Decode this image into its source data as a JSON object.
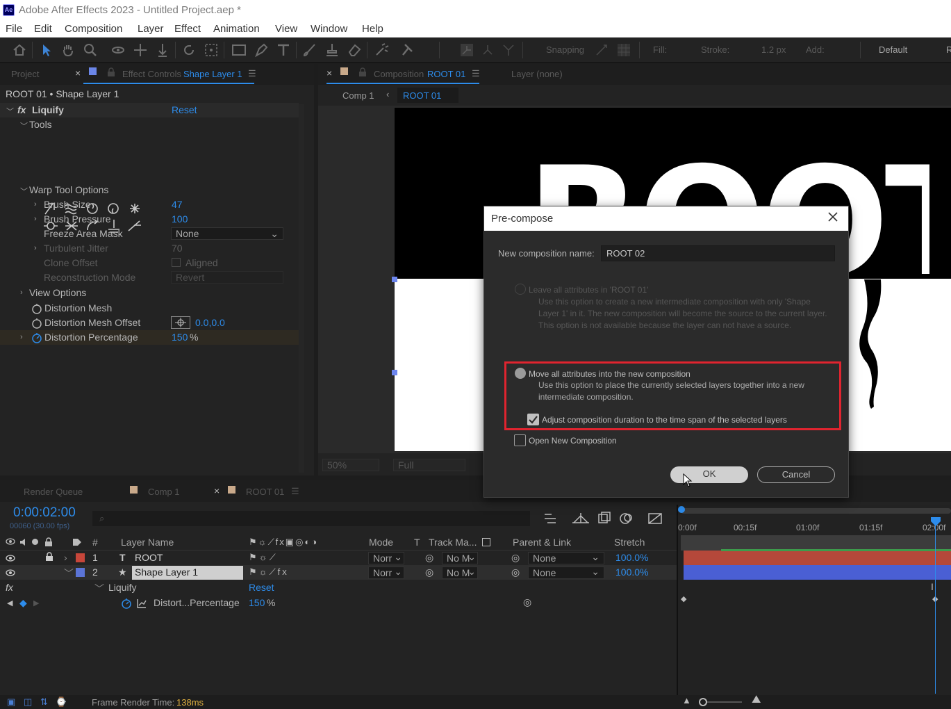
{
  "app": {
    "title": "Adobe After Effects 2023 - Untitled Project.aep *",
    "logo": "Ae"
  },
  "menu": [
    "File",
    "Edit",
    "Composition",
    "Layer",
    "Effect",
    "Animation",
    "View",
    "Window",
    "Help"
  ],
  "toolbar": {
    "snapping_label": "Snapping",
    "fill_label": "Fill:",
    "stroke_label": "Stroke:",
    "stroke_width": "1.2 px",
    "add_label": "Add:",
    "workspace": "Default",
    "workspace_cut": "R"
  },
  "left_panel": {
    "tab_project": "Project",
    "tab_effect_prefix": "Effect Controls",
    "tab_effect_layer": "Shape Layer 1",
    "breadcrumb": "ROOT 01 • Shape Layer 1",
    "effect_name": "Liquify",
    "reset": "Reset",
    "tools_label": "Tools",
    "warp_label": "Warp Tool Options",
    "brush_size_label": "Brush Size",
    "brush_size_value": "47",
    "brush_pressure_label": "Brush Pressure",
    "brush_pressure_value": "100",
    "freeze_label": "Freeze Area Mask",
    "freeze_value": "None",
    "turbulent_label": "Turbulent Jitter",
    "turbulent_value": "70",
    "clone_label": "Clone Offset",
    "clone_value": "Aligned",
    "recon_label": "Reconstruction Mode",
    "recon_value": "Revert",
    "view_options_label": "View Options",
    "mesh_label": "Distortion Mesh",
    "mesh_offset_label": "Distortion Mesh Offset",
    "mesh_offset_value": "0.0,0.0",
    "percentage_label": "Distortion Percentage",
    "percentage_value": "150",
    "percentage_unit": "%"
  },
  "comp_panel": {
    "tab_prefix": "Composition",
    "tab_name": "ROOT 01",
    "layer_tab": "Layer (none)",
    "crumb_comp1": "Comp 1",
    "crumb_root": "ROOT 01",
    "canvas_text": "ROOT",
    "zoom": "50%",
    "resolution": "Full"
  },
  "dialog": {
    "title": "Pre-compose",
    "name_label": "New composition name:",
    "name_value": "ROOT 02",
    "option1_label": "Leave all attributes in 'ROOT 01'",
    "option1_desc": "Use this option to create a new intermediate composition with only 'Shape Layer 1' in it. The new composition will become the source to the current layer. This option is not available because the layer can not have a source.",
    "option2_label": "Move all attributes into the new composition",
    "option2_desc": "Use this option to place the currently selected layers together into a new intermediate composition.",
    "adjust_label": "Adjust composition duration to the time span of the selected layers",
    "open_label": "Open New Composition",
    "ok": "OK",
    "cancel": "Cancel"
  },
  "timeline": {
    "tab_render": "Render Queue",
    "tab_comp1": "Comp 1",
    "tab_root": "ROOT 01",
    "timecode": "0:00:02:00",
    "fps": "00060 (30.00 fps)",
    "search_placeholder": "",
    "col_num": "#",
    "col_layer_name": "Layer Name",
    "col_mode": "Mode",
    "col_t": "T",
    "col_track": "Track Ma...",
    "col_parent": "Parent & Link",
    "col_stretch": "Stretch",
    "layers": [
      {
        "num": "1",
        "type": "T",
        "name": "ROOT",
        "mode": "Norr",
        "track": "No M",
        "parent": "None",
        "stretch": "100.0%",
        "color": "#c7463a"
      },
      {
        "num": "2",
        "type": "★",
        "name": "Shape Layer 1",
        "mode": "Norr",
        "track": "No M",
        "parent": "None",
        "stretch": "100.0%",
        "color": "#5b74d6"
      }
    ],
    "fx_label": "fx",
    "effect_row": "Liquify",
    "effect_reset": "Reset",
    "prop_row": "Distort...Percentage",
    "prop_value": "150",
    "prop_unit": "%",
    "ruler": [
      "0:00f",
      "00:15f",
      "01:00f",
      "01:15f",
      "02:00f"
    ]
  },
  "status": {
    "render_label": "Frame Render Time:",
    "render_value": "138ms"
  },
  "colors": {
    "accent_blue": "#2d8ceb",
    "highlight_red": "#e0242f",
    "layer_red_bar": "#b5483a",
    "layer_blue_bar": "#4a5fd4"
  }
}
